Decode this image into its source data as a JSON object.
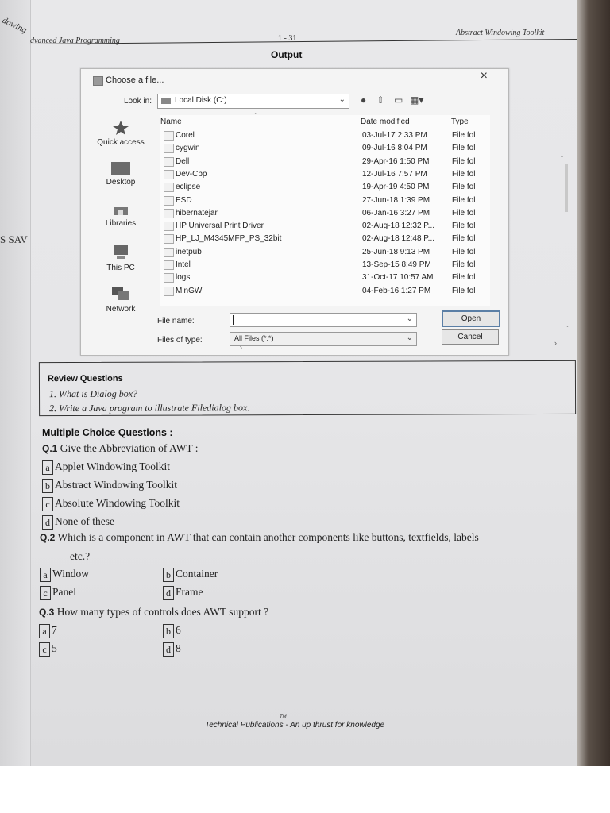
{
  "fold_text": {
    "top": "dowing",
    "middle": "S SAV"
  },
  "header": {
    "left": "dvanced Java Programming",
    "center": "1 - 31",
    "right": "Abstract Windowing Toolkit"
  },
  "output_title": "Output",
  "dialog": {
    "title": "Choose a file...",
    "close": "×",
    "look_in_label": "Look in:",
    "look_in_value": "Local Disk (C:)",
    "places": [
      "Quick access",
      "Desktop",
      "Libraries",
      "This PC",
      "Network"
    ],
    "columns": {
      "name": "Name",
      "date": "Date modified",
      "type": "Type"
    },
    "files": [
      {
        "name": "Corel",
        "date": "03-Jul-17 2:33 PM",
        "type": "File fol"
      },
      {
        "name": "cygwin",
        "date": "09-Jul-16 8:04 PM",
        "type": "File fol"
      },
      {
        "name": "Dell",
        "date": "29-Apr-16 1:50 PM",
        "type": "File fol"
      },
      {
        "name": "Dev-Cpp",
        "date": "12-Jul-16 7:57 PM",
        "type": "File fol"
      },
      {
        "name": "eclipse",
        "date": "19-Apr-19 4:50 PM",
        "type": "File fol"
      },
      {
        "name": "ESD",
        "date": "27-Jun-18 1:39 PM",
        "type": "File fol"
      },
      {
        "name": "hibernatejar",
        "date": "06-Jan-16 3:27 PM",
        "type": "File fol"
      },
      {
        "name": "HP Universal Print Driver",
        "date": "02-Aug-18 12:32 P...",
        "type": "File fol"
      },
      {
        "name": "HP_LJ_M4345MFP_PS_32bit",
        "date": "02-Aug-18 12:48 P...",
        "type": "File fol"
      },
      {
        "name": "inetpub",
        "date": "25-Jun-18 9:13 PM",
        "type": "File fol"
      },
      {
        "name": "Intel",
        "date": "13-Sep-15 8:49 PM",
        "type": "File fol"
      },
      {
        "name": "logs",
        "date": "31-Oct-17 10:57 AM",
        "type": "File fol"
      },
      {
        "name": "MinGW",
        "date": "04-Feb-16 1:27 PM",
        "type": "File fol"
      }
    ],
    "file_name_label": "File name:",
    "file_name_value": "",
    "file_type_label": "Files of type:",
    "file_type_value": "All Files (*.*)",
    "open_label": "Open",
    "cancel_label": "Cancel"
  },
  "review": {
    "title": "Review Questions",
    "questions": [
      "1. What is Dialog box?",
      "2. Write a Java program to illustrate Filedialog box."
    ]
  },
  "mcq": {
    "title": "Multiple Choice Questions :",
    "q1": {
      "num": "Q.1",
      "text": "Give the Abbreviation of AWT :",
      "options": [
        {
          "letter": "a",
          "text": "Applet Windowing Toolkit"
        },
        {
          "letter": "b",
          "text": "Abstract Windowing Toolkit"
        },
        {
          "letter": "c",
          "text": "Absolute Windowing Toolkit"
        },
        {
          "letter": "d",
          "text": "None of these"
        }
      ]
    },
    "q2": {
      "num": "Q.2",
      "text": "Which is a component in AWT that can contain another components like buttons, textfields, labels",
      "text2": "etc.?",
      "options": [
        {
          "letter": "a",
          "text": "Window"
        },
        {
          "letter": "b",
          "text": "Container"
        },
        {
          "letter": "c",
          "text": "Panel"
        },
        {
          "letter": "d",
          "text": "Frame"
        }
      ]
    },
    "q3": {
      "num": "Q.3",
      "text": "How many types of controls does AWT support ?",
      "options": [
        {
          "letter": "a",
          "text": "7"
        },
        {
          "letter": "b",
          "text": "6"
        },
        {
          "letter": "c",
          "text": "5"
        },
        {
          "letter": "d",
          "text": "8"
        }
      ]
    }
  },
  "footer": {
    "publisher": "Technical Publications",
    "tm": "TM",
    "slogan": "- An up thrust for knowledge"
  }
}
